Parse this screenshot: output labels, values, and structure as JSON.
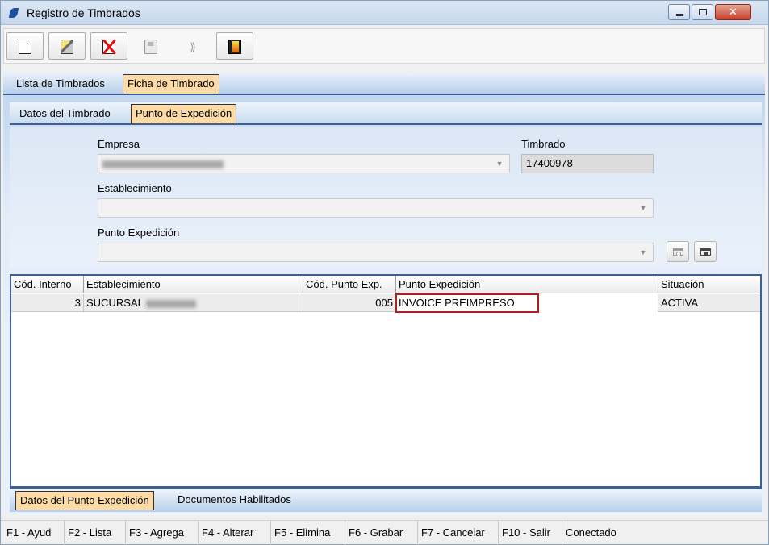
{
  "window": {
    "title": "Registro de Timbrados",
    "controls": {
      "minimize": "minimize-icon",
      "maximize": "maximize-icon",
      "close": "close-icon"
    }
  },
  "toolbar": {
    "buttons": [
      {
        "icon": "new-document-icon",
        "enabled": true
      },
      {
        "icon": "edit-document-icon",
        "enabled": true
      },
      {
        "icon": "delete-icon",
        "enabled": true
      },
      {
        "icon": "save-icon",
        "enabled": false
      },
      {
        "icon": "cancel-icon",
        "enabled": false
      },
      {
        "icon": "exit-door-icon",
        "enabled": true
      }
    ]
  },
  "outer_tabs": [
    {
      "label": "Lista de Timbrados",
      "active": false
    },
    {
      "label": "Ficha de Timbrado",
      "active": true
    }
  ],
  "inner_tabs": [
    {
      "label": "Datos del Timbrado",
      "active": false
    },
    {
      "label": "Punto de Expedición",
      "active": true
    }
  ],
  "form": {
    "empresa_label": "Empresa",
    "empresa_value": "",
    "timbrado_label": "Timbrado",
    "timbrado_value": "17400978",
    "establecimiento_label": "Establecimiento",
    "establecimiento_value": "",
    "punto_label": "Punto Expedición",
    "punto_value": ""
  },
  "grid": {
    "columns": [
      "Cód. Interno",
      "Establecimiento",
      "Cód. Punto Exp.",
      "Punto Expedición",
      "Situación"
    ],
    "rows": [
      {
        "cod_interno": "3",
        "establecimiento": "SUCURSAL",
        "cod_punto": "005",
        "punto": "INVOICE PREIMPRESO",
        "situacion": "ACTIVA"
      }
    ]
  },
  "bottom_tabs": [
    {
      "label": "Datos del Punto Expedición",
      "active": true
    },
    {
      "label": "Documentos Habilitados",
      "active": false
    }
  ],
  "statusbar": {
    "items": [
      "F1 - Ayud",
      "F2 - Lista",
      "F3 - Agrega",
      "F4 - Alterar",
      "F5 - Elimina",
      "F6 - Grabar",
      "F7 - Cancelar",
      "F10 - Salir",
      "Conectado"
    ]
  },
  "colors": {
    "active_tab": "#fcdba7",
    "accent_border": "#3d5f95",
    "highlight": "#b01e1e"
  }
}
